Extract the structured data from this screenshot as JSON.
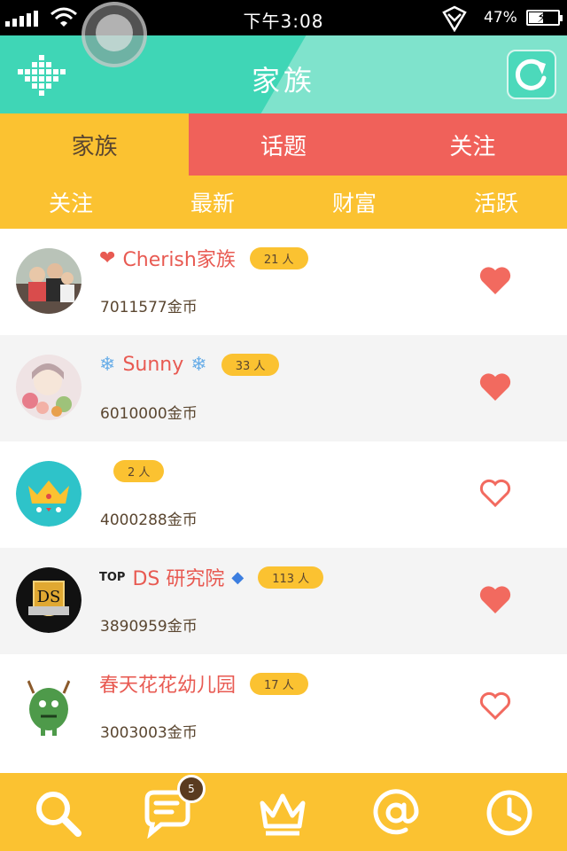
{
  "status_bar": {
    "time": "下午3:08",
    "battery_percent": "47%",
    "battery_level": 0.47
  },
  "header": {
    "title": "家族"
  },
  "main_tabs": [
    {
      "label": "家族",
      "active": true
    },
    {
      "label": "话题",
      "active": false
    },
    {
      "label": "关注",
      "active": false
    }
  ],
  "sub_tabs": [
    {
      "label": "关注"
    },
    {
      "label": "最新"
    },
    {
      "label": "财富"
    },
    {
      "label": "活跃"
    }
  ],
  "families": [
    {
      "name": "Cherish家族",
      "prefix": "❤",
      "suffix": "",
      "members": "21 人",
      "coins": "7011577金币",
      "followed": true,
      "avatar": "photo-icon"
    },
    {
      "name": "Sunny",
      "prefix": "❄",
      "suffix": "❄",
      "members": "33 人",
      "coins": "6010000金币",
      "followed": true,
      "avatar": "anime-girl-icon"
    },
    {
      "name": "",
      "prefix": "",
      "suffix": "",
      "members": "2 人",
      "coins": "4000288金币",
      "followed": false,
      "avatar": "crown-icon"
    },
    {
      "name": "DS 研究院",
      "prefix": "TOP",
      "suffix": "◆",
      "members": "113 人",
      "coins": "3890959金币",
      "followed": true,
      "avatar": "ds-emblem-icon"
    },
    {
      "name": "春天花花幼儿园",
      "prefix": "",
      "suffix": "",
      "members": "17 人",
      "coins": "3003003金币",
      "followed": false,
      "avatar": "monster-icon"
    }
  ],
  "bottom_bar": {
    "icons": [
      "search-icon",
      "chat-icon",
      "crown-icon",
      "at-icon",
      "clock-icon"
    ],
    "message_count": "5"
  },
  "colors": {
    "header": "#3fd6b6",
    "accent_yellow": "#fbc231",
    "accent_red": "#f0615a",
    "heart": "#f26a5f"
  }
}
